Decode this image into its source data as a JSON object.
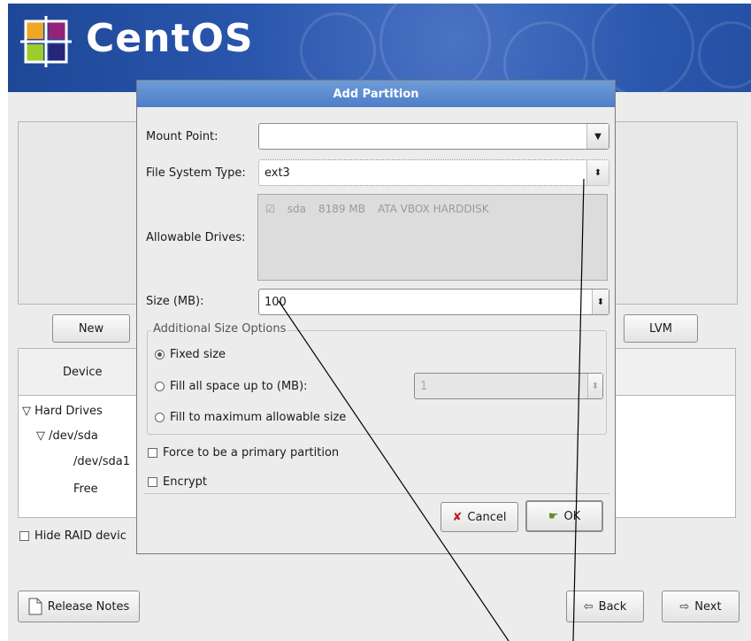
{
  "banner": {
    "logo_text": "CentOS"
  },
  "main": {
    "buttons": {
      "new": "New",
      "lvm": "LVM"
    },
    "device_header": "Device",
    "tree": [
      "Hard Drives",
      "/dev/sda",
      "/dev/sda1",
      "Free"
    ],
    "hide_raid": "Hide RAID devic",
    "release_notes": "Release Notes",
    "back": "Back",
    "next": "Next"
  },
  "dialog": {
    "title": "Add Partition",
    "mount_point_label": "Mount Point:",
    "mount_point_value": "",
    "fs_type_label": "File System Type:",
    "fs_type_value": "ext3",
    "allowable_drives_label": "Allowable Drives:",
    "drive": {
      "name": "sda",
      "size": "8189 MB",
      "model": "ATA VBOX HARDDISK",
      "checked": true
    },
    "size_label": "Size (MB):",
    "size_value": "100",
    "additional_title": "Additional Size Options",
    "options": [
      "Fixed size",
      "Fill all space up to (MB):",
      "Fill to maximum allowable size"
    ],
    "selected_option": 0,
    "fill_up_value": "1",
    "force_primary": "Force to be a primary partition",
    "encrypt": "Encrypt",
    "cancel": "Cancel",
    "ok": "OK"
  }
}
